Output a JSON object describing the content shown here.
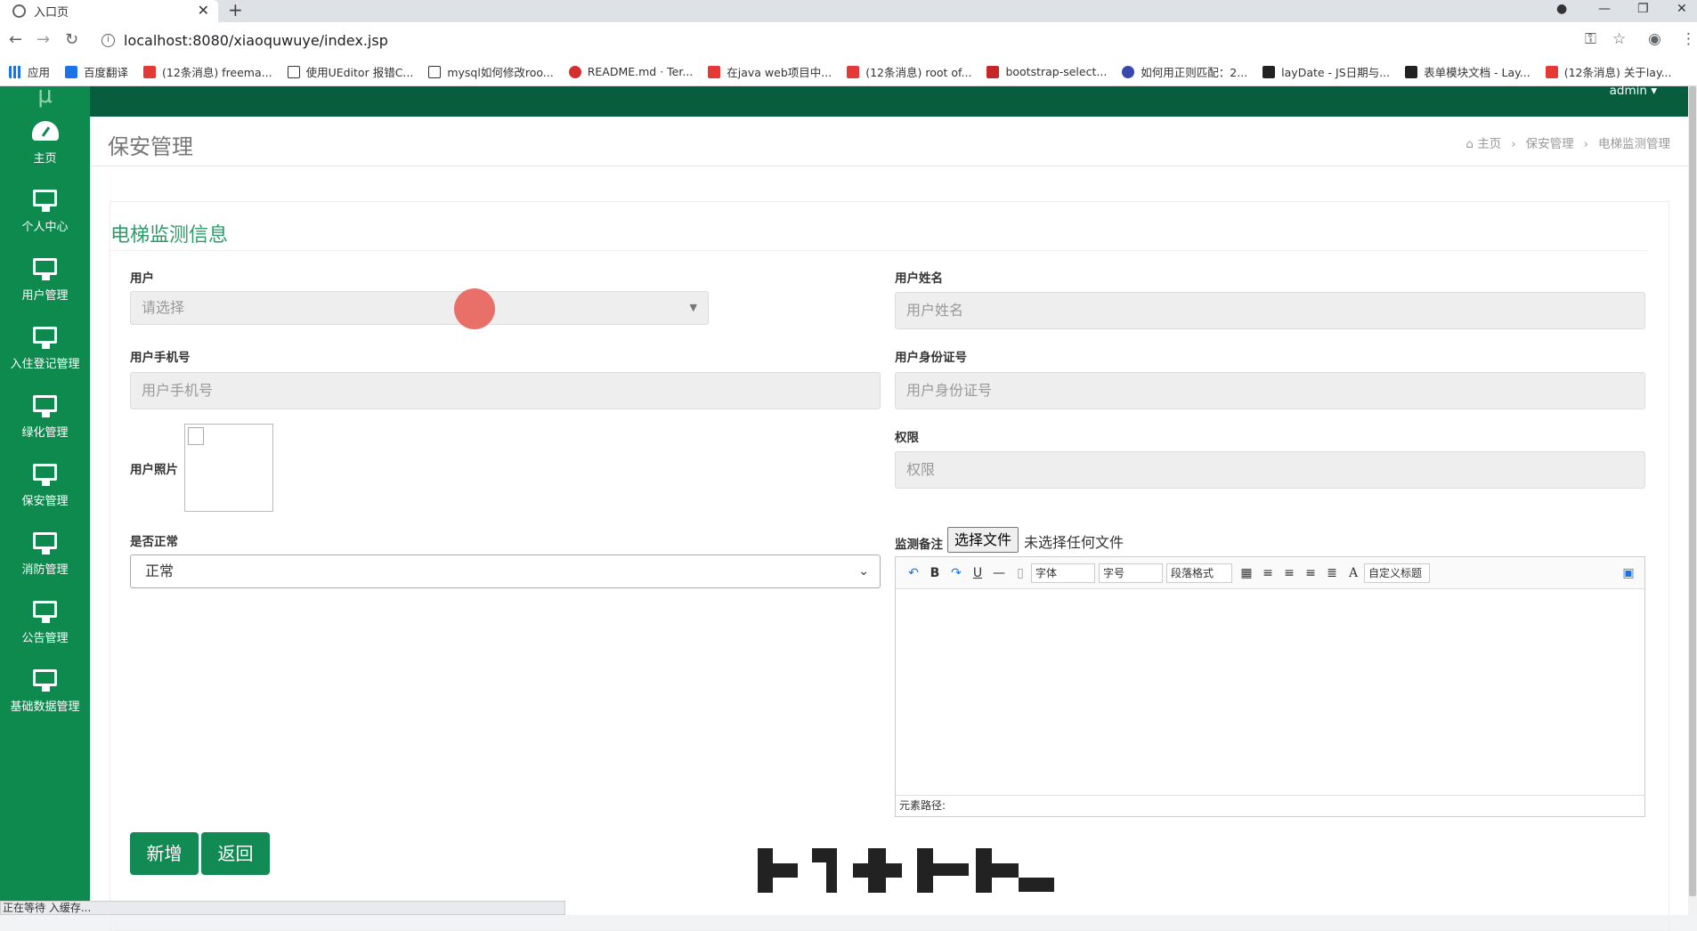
{
  "browser": {
    "tab_title": "入口页",
    "url": "localhost:8080/xiaoquwuye/index.jsp",
    "bookmarks": [
      "应用",
      "百度翻译",
      "(12条消息) freema...",
      "使用UEditor 报错C...",
      "mysql如何修改roo...",
      "README.md · Ter...",
      "在java web项目中...",
      "(12条消息) root of...",
      "bootstrap-select...",
      "如何用正则匹配：2...",
      "layDate - JS日期与...",
      "表单模块文档 - Lay...",
      "(12条消息) 关于lay..."
    ],
    "status_text": "正在等待 入缓存..."
  },
  "colors": {
    "sidebar": "#0f8a4f",
    "topnav": "#075d3e",
    "accent": "#2e9b6a",
    "button": "#128a53"
  },
  "topnav": {
    "user": "admin ▾"
  },
  "sidebar": {
    "logo": "μ",
    "items": [
      {
        "label": "主页",
        "icon": "dashboard-icon"
      },
      {
        "label": "个人中心",
        "icon": "monitor-icon"
      },
      {
        "label": "用户管理",
        "icon": "monitor-icon"
      },
      {
        "label": "入住登记管理",
        "icon": "monitor-icon"
      },
      {
        "label": "绿化管理",
        "icon": "monitor-icon"
      },
      {
        "label": "保安管理",
        "icon": "monitor-icon"
      },
      {
        "label": "消防管理",
        "icon": "monitor-icon"
      },
      {
        "label": "公告管理",
        "icon": "monitor-icon"
      },
      {
        "label": "基础数据管理",
        "icon": "monitor-icon"
      }
    ]
  },
  "page": {
    "title": "保安管理",
    "breadcrumb": {
      "home": "主页",
      "level1": "保安管理",
      "level2": "电梯监测管理"
    }
  },
  "form": {
    "title": "电梯监测信息",
    "user_label": "用户",
    "user_placeholder": "请选择",
    "username_label": "用户姓名",
    "username_placeholder": "用户姓名",
    "phone_label": "用户手机号",
    "phone_placeholder": "用户手机号",
    "idcard_label": "用户身份证号",
    "idcard_placeholder": "用户身份证号",
    "photo_label": "用户照片",
    "permission_label": "权限",
    "permission_placeholder": "权限",
    "normal_label": "是否正常",
    "normal_value": "正常",
    "remark_label": "监测备注",
    "file_button": "选择文件",
    "file_status": "未选择任何文件",
    "editor": {
      "font": "字体",
      "size": "字号",
      "paragraph": "段落格式",
      "custom_title": "自定义标题",
      "path_label": "元素路径:"
    },
    "add_button": "新增",
    "back_button": "返回"
  }
}
